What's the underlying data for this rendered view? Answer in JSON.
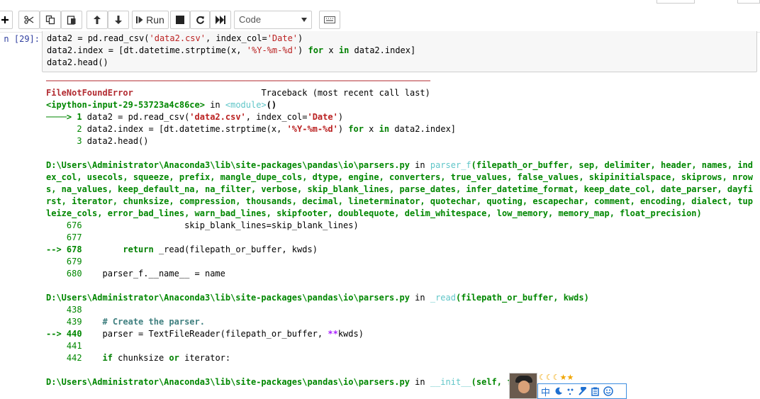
{
  "toolbar": {
    "run_label": "Run",
    "cell_type": "Code",
    "icons": [
      "add-cell-icon",
      "cut-icon",
      "copy-icon",
      "paste-icon",
      "move-up-icon",
      "move-down-icon",
      "run-icon",
      "stop-icon",
      "restart-icon",
      "fast-forward-icon",
      "keyboard-icon"
    ]
  },
  "cell": {
    "prompt": "n  [29]:",
    "code": [
      "data2 = pd.read_csv('data2.csv', index_col='Date')",
      "data2.index = [dt.datetime.strptime(x, '%Y-%m-%d') for x in data2.index]",
      "data2.head()"
    ]
  },
  "output": {
    "separator": "───────────────────────────────────────────────────────────────────────────",
    "error_name": "FileNotFoundError",
    "traceback_label": "Traceback (most recent call last)",
    "ipython_input": "<ipython-input-29-53723a4c86ce>",
    "in_word": " in ",
    "module": "<module>",
    "module_parens": "()",
    "frame1": {
      "lines": [
        {
          "arrow": "────> 1 ",
          "code": "data2 = pd.read_csv('data2.csv', index_col='Date')"
        },
        {
          "arrow": "      2 ",
          "code": "data2.index = [dt.datetime.strptime(x, '%Y-%m-%d') for x in data2.index]"
        },
        {
          "arrow": "      3 ",
          "code": "data2.head()"
        }
      ]
    },
    "frame2": {
      "path": "D:\\Users\\Administrator\\Anaconda3\\lib\\site-packages\\pandas\\io\\parsers.py",
      "in_word": " in ",
      "func": "parser_f",
      "signature": "(filepath_or_buffer, sep, delimiter, header, names, index_col, usecols, squeeze, prefix, mangle_dupe_cols, dtype, engine, converters, true_values, false_values, skipinitialspace, skiprows, nrows, na_values, keep_default_na, na_filter, verbose, skip_blank_lines, parse_dates, infer_datetime_format, keep_date_col, date_parser, dayfirst, iterator, chunksize, compression, thousands, decimal, lineterminator, quotechar, quoting, escapechar, comment, encoding, dialect, tupleize_cols, error_bad_lines, warn_bad_lines, skipfooter, doublequote, delim_whitespace, low_memory, memory_map, float_precision)",
      "lines": [
        {
          "no": "    676",
          "code": "                    skip_blank_lines=skip_blank_lines)"
        },
        {
          "no": "    677",
          "code": ""
        },
        {
          "no": "--> 678",
          "code": "        return _read(filepath_or_buffer, kwds)"
        },
        {
          "no": "    679",
          "code": ""
        },
        {
          "no": "    680",
          "code": "    parser_f.__name__ = name"
        }
      ]
    },
    "frame3": {
      "path": "D:\\Users\\Administrator\\Anaconda3\\lib\\site-packages\\pandas\\io\\parsers.py",
      "in_word": " in ",
      "func": "_read",
      "signature": "(filepath_or_buffer, kwds)",
      "lines": [
        {
          "no": "    438",
          "code": ""
        },
        {
          "no": "    439",
          "code": "    # Create the parser."
        },
        {
          "no": "--> 440",
          "code": "    parser = TextFileReader(filepath_or_buffer, **kwds)"
        },
        {
          "no": "    441",
          "code": ""
        },
        {
          "no": "    442",
          "code": "    if chunksize or iterator:"
        }
      ]
    },
    "frame4": {
      "path": "D:\\Users\\Administrator\\Anaconda3\\lib\\site-packages\\pandas\\io\\parsers.py",
      "in_word": " in ",
      "func": "__init__",
      "signature": "(self, f"
    }
  },
  "ime": {
    "stars": "☾☾☾★★",
    "lang": "中",
    "icons": [
      "moon-icon",
      "punctuation-icon",
      "wrench-icon",
      "clipboard-icon",
      "smiley-icon"
    ]
  }
}
